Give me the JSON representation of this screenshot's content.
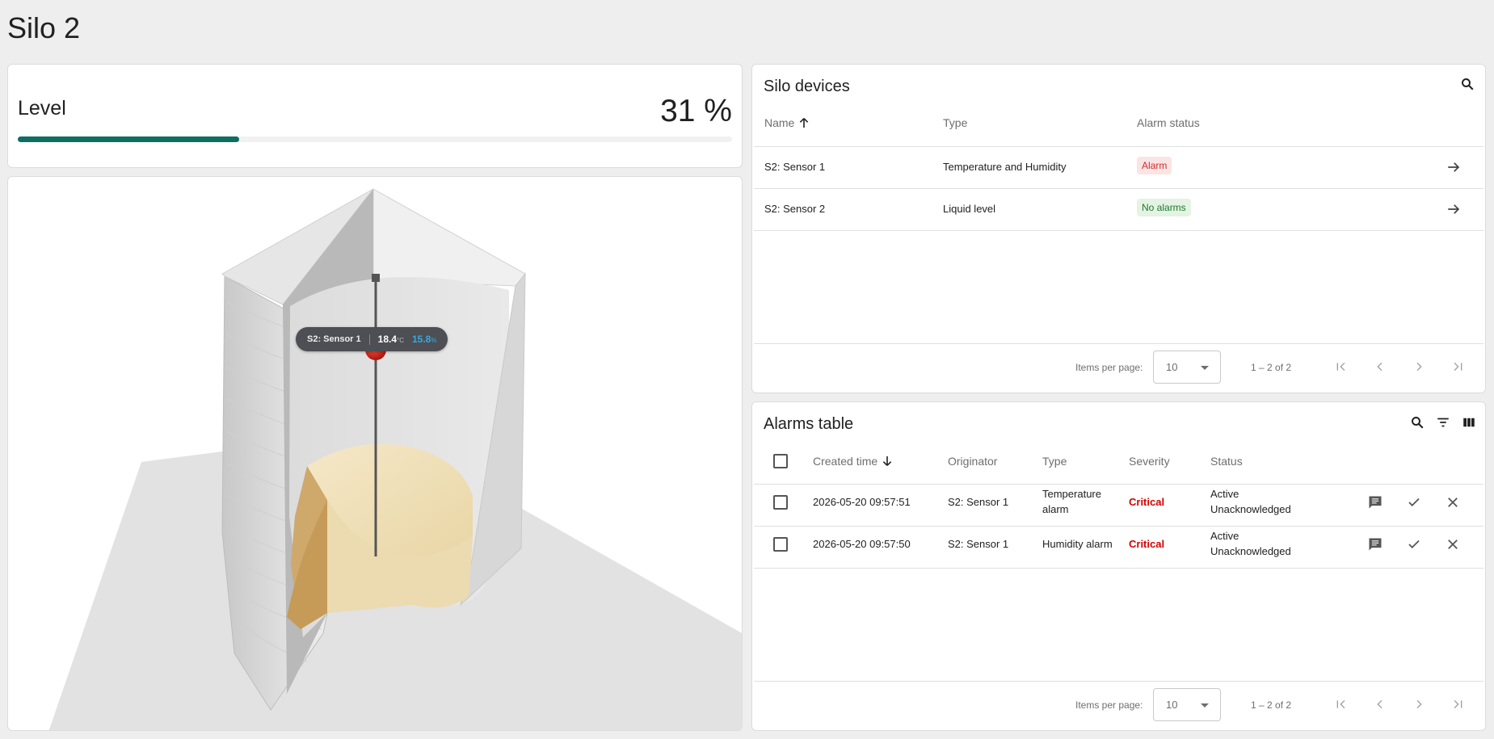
{
  "page": {
    "title": "Silo 2"
  },
  "level": {
    "title": "Level",
    "value_text": "31 %",
    "value_fraction": 0.31,
    "bar_color": "#0f6e62"
  },
  "scene": {
    "tooltip": {
      "sensor": "S2: Sensor 1",
      "temperature": "18.4",
      "temperature_unit": "°C",
      "humidity": "15.8",
      "humidity_unit": "%"
    }
  },
  "devices": {
    "title": "Silo devices",
    "columns": {
      "name": "Name",
      "type": "Type",
      "alarm_status": "Alarm status"
    },
    "rows": [
      {
        "name": "S2: Sensor 1",
        "type": "Temperature and Humidity",
        "alarm_status": "Alarm"
      },
      {
        "name": "S2: Sensor 2",
        "type": "Liquid level",
        "alarm_status": "No alarms"
      }
    ],
    "pager": {
      "items_label": "Items per page:",
      "page_size": "10",
      "range": "1 – 2 of 2"
    }
  },
  "alarms": {
    "title": "Alarms table",
    "columns": {
      "created": "Created time",
      "originator": "Originator",
      "type": "Type",
      "severity": "Severity",
      "status": "Status"
    },
    "rows": [
      {
        "created": "2026-05-20 09:57:51",
        "originator": "S2: Sensor 1",
        "type_line1": "Temperature",
        "type_line2": "alarm",
        "severity": "Critical",
        "status_line1": "Active",
        "status_line2": "Unacknowledged"
      },
      {
        "created": "2026-05-20 09:57:50",
        "originator": "S2: Sensor 1",
        "type_line1": "Humidity alarm",
        "type_line2": "",
        "severity": "Critical",
        "status_line1": "Active",
        "status_line2": "Unacknowledged"
      }
    ],
    "pager": {
      "items_label": "Items per page:",
      "page_size": "10",
      "range": "1 – 2 of 2"
    }
  },
  "colors": {
    "alarm_red": "#d12d2d",
    "critical_red": "#d50000",
    "ok_green": "#1f7a2c"
  }
}
